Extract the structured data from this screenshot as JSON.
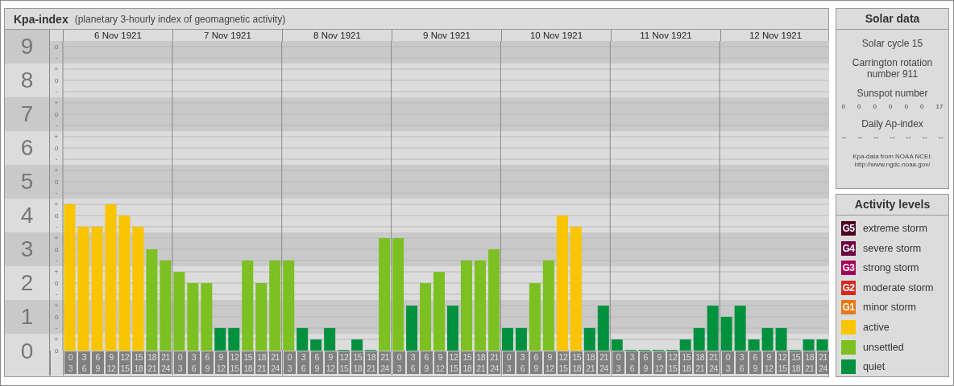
{
  "kpa_panel": {
    "title": "Kpa-index",
    "subtitle": "(planetary 3-hourly index of geomagnetic activity)",
    "sub_level_marks": [
      "o",
      "-",
      "+",
      "o",
      "-",
      "+",
      "o",
      "-",
      "+",
      "o",
      "-",
      "+",
      "o",
      "-",
      "+",
      "o",
      "-",
      "+",
      "o",
      "-",
      "+",
      "o",
      "-",
      "+",
      "o",
      "-",
      "+",
      "o"
    ],
    "days": [
      {
        "date": "6 Nov 1921",
        "slots": [
          {
            "start": "0",
            "end": "3"
          },
          {
            "start": "3",
            "end": "6"
          },
          {
            "start": "6",
            "end": "9"
          },
          {
            "start": "9",
            "end": "12"
          },
          {
            "start": "12",
            "end": "15"
          },
          {
            "start": "15",
            "end": "18"
          },
          {
            "start": "18",
            "end": "21"
          },
          {
            "start": "21",
            "end": "24"
          }
        ]
      },
      {
        "date": "7 Nov 1921",
        "slots": [
          {
            "start": "0",
            "end": "3"
          },
          {
            "start": "3",
            "end": "6"
          },
          {
            "start": "6",
            "end": "9"
          },
          {
            "start": "9",
            "end": "12"
          },
          {
            "start": "12",
            "end": "15"
          },
          {
            "start": "15",
            "end": "18"
          },
          {
            "start": "18",
            "end": "21"
          },
          {
            "start": "21",
            "end": "24"
          }
        ]
      },
      {
        "date": "8 Nov 1921",
        "slots": [
          {
            "start": "0",
            "end": "3"
          },
          {
            "start": "3",
            "end": "6"
          },
          {
            "start": "6",
            "end": "9"
          },
          {
            "start": "9",
            "end": "12"
          },
          {
            "start": "12",
            "end": "15"
          },
          {
            "start": "15",
            "end": "18"
          },
          {
            "start": "18",
            "end": "21"
          },
          {
            "start": "21",
            "end": "24"
          }
        ]
      },
      {
        "date": "9 Nov 1921",
        "slots": [
          {
            "start": "0",
            "end": "3"
          },
          {
            "start": "3",
            "end": "6"
          },
          {
            "start": "6",
            "end": "9"
          },
          {
            "start": "9",
            "end": "12"
          },
          {
            "start": "12",
            "end": "15"
          },
          {
            "start": "15",
            "end": "18"
          },
          {
            "start": "18",
            "end": "21"
          },
          {
            "start": "21",
            "end": "24"
          }
        ]
      },
      {
        "date": "10 Nov 1921",
        "slots": [
          {
            "start": "0",
            "end": "3"
          },
          {
            "start": "3",
            "end": "6"
          },
          {
            "start": "6",
            "end": "9"
          },
          {
            "start": "9",
            "end": "12"
          },
          {
            "start": "12",
            "end": "15"
          },
          {
            "start": "15",
            "end": "18"
          },
          {
            "start": "18",
            "end": "21"
          },
          {
            "start": "21",
            "end": "24"
          }
        ]
      },
      {
        "date": "11 Nov 1921",
        "slots": [
          {
            "start": "0",
            "end": "3"
          },
          {
            "start": "3",
            "end": "6"
          },
          {
            "start": "6",
            "end": "9"
          },
          {
            "start": "9",
            "end": "12"
          },
          {
            "start": "12",
            "end": "15"
          },
          {
            "start": "15",
            "end": "18"
          },
          {
            "start": "18",
            "end": "21"
          },
          {
            "start": "21",
            "end": "24"
          }
        ]
      },
      {
        "date": "12 Nov 1921",
        "slots": [
          {
            "start": "0",
            "end": "3"
          },
          {
            "start": "3",
            "end": "6"
          },
          {
            "start": "6",
            "end": "9"
          },
          {
            "start": "9",
            "end": "12"
          },
          {
            "start": "12",
            "end": "15"
          },
          {
            "start": "15",
            "end": "18"
          },
          {
            "start": "18",
            "end": "21"
          },
          {
            "start": "21",
            "end": "24"
          }
        ]
      }
    ],
    "chart_data": {
      "type": "bar",
      "ylim": [
        0,
        9
      ],
      "grid": true,
      "yticks": [
        {
          "value": 9,
          "label": "9"
        },
        {
          "value": 8,
          "label": "8"
        },
        {
          "value": 7,
          "label": "7"
        },
        {
          "value": 6,
          "label": "6"
        },
        {
          "value": 5,
          "label": "5"
        },
        {
          "value": 4,
          "label": "4"
        },
        {
          "value": 3,
          "label": "3"
        },
        {
          "value": 2,
          "label": "2"
        },
        {
          "value": 1,
          "label": "1"
        },
        {
          "value": 0,
          "label": "0"
        }
      ],
      "values": [
        4.33,
        3.67,
        3.67,
        4.33,
        4,
        3.67,
        3,
        2.67,
        2.33,
        2,
        2,
        0.67,
        0.67,
        2.67,
        2,
        2.67,
        2.67,
        0.67,
        0.33,
        0.67,
        0,
        0.33,
        0,
        3.33,
        3.33,
        1.33,
        2,
        2.33,
        1.33,
        2.67,
        2.67,
        3,
        0.67,
        0.67,
        2,
        2.67,
        4,
        3.67,
        0.67,
        1.33,
        0.33,
        0,
        0,
        0,
        0,
        0.33,
        0.67,
        1.33,
        1,
        1.33,
        0.33,
        0.67,
        0.67,
        0,
        0.33,
        0.33
      ]
    }
  },
  "solar_data": {
    "title": "Solar data",
    "solar_cycle": "Solar cycle 15",
    "carrington": "Carrington rotation number 911",
    "sunspot_label": "Sunspot number",
    "sunspot_numbers": [
      "0",
      "0",
      "0",
      "0",
      "0",
      "0",
      "17"
    ],
    "ap_label": "Daily Ap-index",
    "ap_values": [
      "--",
      "--",
      "--",
      "--",
      "--",
      "--",
      "--"
    ],
    "source": "Kpa-data from NOAA NCEI:",
    "source_url": "http://www.ngdc.noaa.gov/"
  },
  "activity_levels": {
    "title": "Activity levels",
    "items": [
      {
        "badge": "G5",
        "label": "extreme storm",
        "color": "#4d0026"
      },
      {
        "badge": "G4",
        "label": "severe storm",
        "color": "#6b0040"
      },
      {
        "badge": "G3",
        "label": "strong storm",
        "color": "#a3005c"
      },
      {
        "badge": "G2",
        "label": "moderate storm",
        "color": "#d52b1e"
      },
      {
        "badge": "G1",
        "label": "minor storm",
        "color": "#e67817"
      },
      {
        "label": "active",
        "color": "#f9c400"
      },
      {
        "label": "unsettled",
        "color": "#7cc021"
      },
      {
        "label": "quiet",
        "color": "#00913f"
      }
    ]
  }
}
